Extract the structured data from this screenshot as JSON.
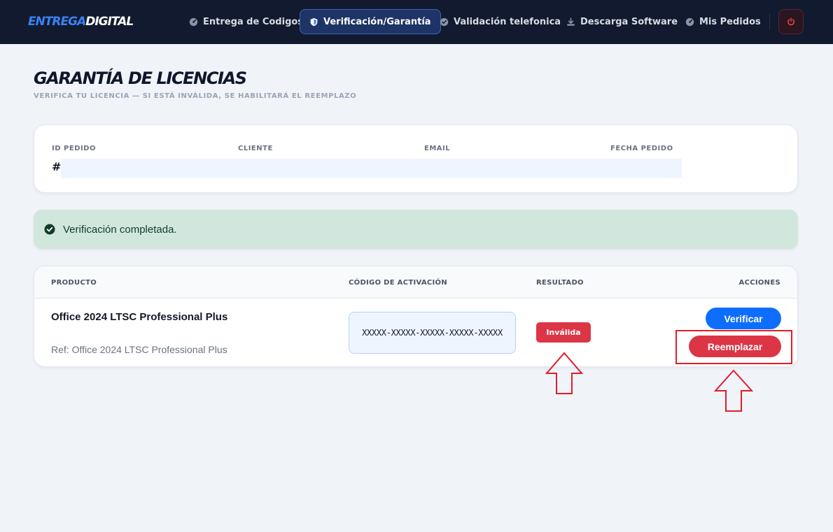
{
  "brand": {
    "part1": "ENTREGA",
    "part2": "DIGITAL"
  },
  "nav": {
    "items": [
      {
        "label": "Entrega de Codigos",
        "icon": "dashboard-icon"
      },
      {
        "label": "Verificación/Garantía",
        "icon": "shield-icon",
        "active": true
      },
      {
        "label": "Validación telefonica",
        "icon": "check-circle-icon"
      },
      {
        "label": "Descarga Software",
        "icon": "download-icon"
      },
      {
        "label": "Mis Pedidos",
        "icon": "dashboard-icon"
      }
    ],
    "logout_icon": "power-icon"
  },
  "page": {
    "title": "GARANTÍA DE LICENCIAS",
    "subtitle": "VERIFICA TU LICENCIA — SI ESTÁ INVÁLIDA, SE HABILITARÁ EL REEMPLAZO"
  },
  "order": {
    "labels": {
      "id": "ID PEDIDO",
      "client": "CLIENTE",
      "email": "EMAIL",
      "date": "FECHA PEDIDO"
    },
    "hash": "#",
    "values": {
      "id": "",
      "client": "",
      "email": "",
      "date": ""
    }
  },
  "alert": {
    "text": "Verificación completada.",
    "icon": "check-circle-icon",
    "color": "#d1e7dd"
  },
  "table": {
    "headers": {
      "product": "PRODUCTO",
      "code": "CÓDIGO DE ACTIVACIÓN",
      "result": "RESULTADO",
      "actions": "ACCIONES"
    },
    "rows": [
      {
        "product": "Office 2024 LTSC Professional Plus",
        "ref": "Ref: Office 2024 LTSC Professional Plus",
        "code": "XXXXX-XXXXX-XXXXX-XXXXX-XXXXX",
        "result": "Inválida",
        "verify_label": "Verificar",
        "replace_label": "Reemplazar"
      }
    ]
  },
  "colors": {
    "navbar": "#111a2e",
    "accent": "#0d6efd",
    "danger": "#dc3545",
    "success_bg": "#d1e7dd",
    "annotation": "#e11d2a"
  }
}
